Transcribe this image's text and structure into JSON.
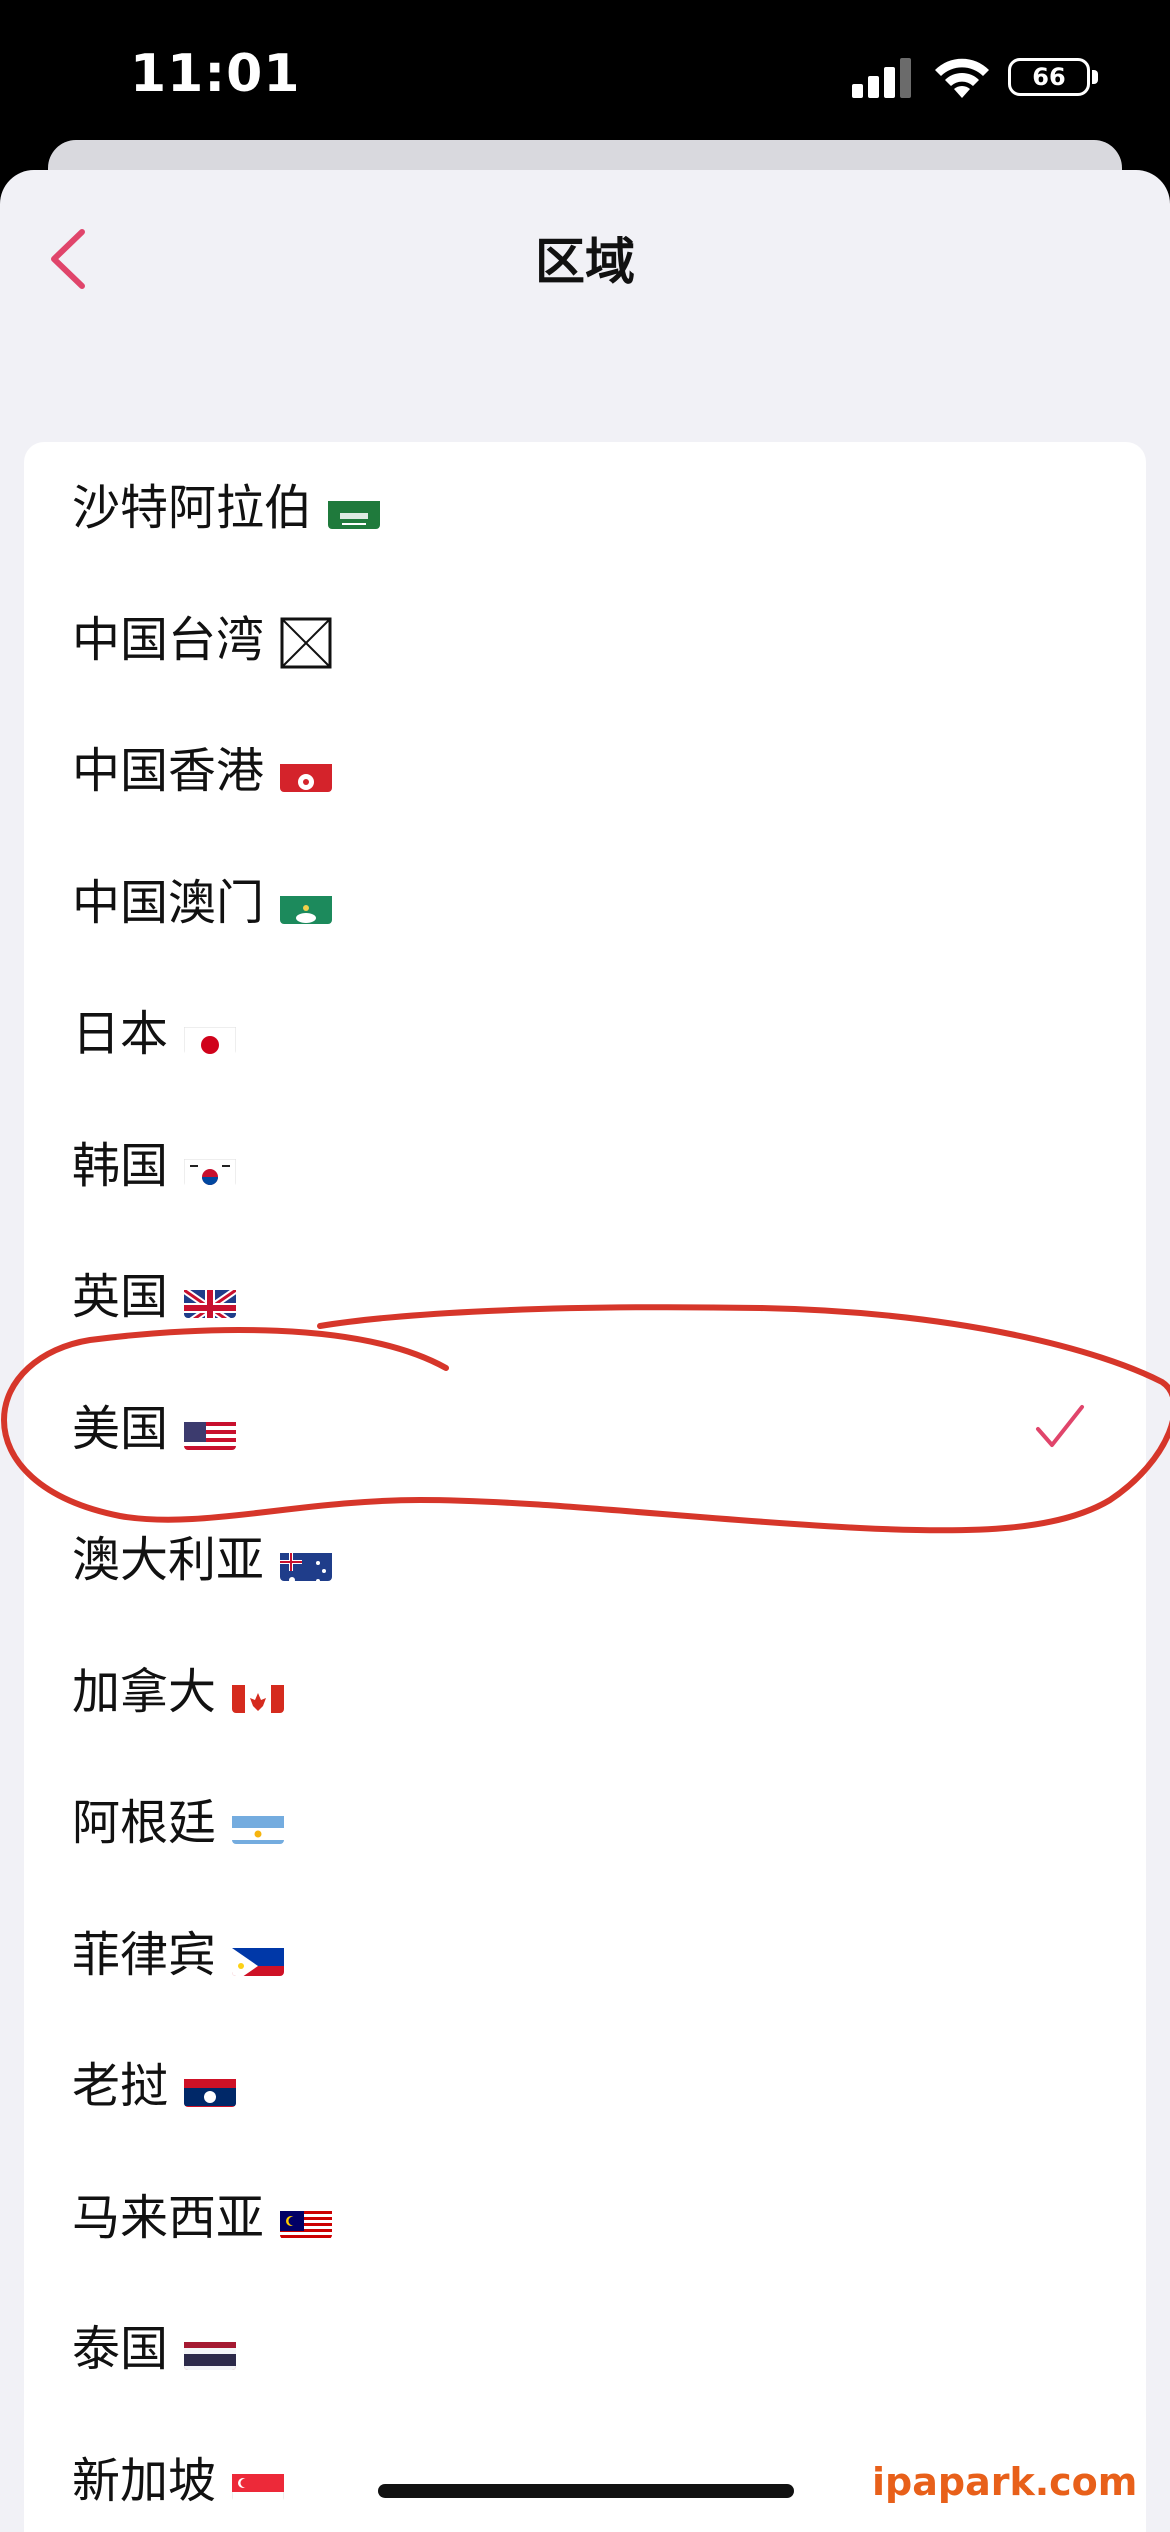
{
  "status": {
    "time": "11:01",
    "battery": "66"
  },
  "header": {
    "title": "区域"
  },
  "regions": [
    {
      "label": "沙特阿拉伯",
      "flag": "saudi-arabia"
    },
    {
      "label": "中国台湾",
      "flag": "placeholder-box"
    },
    {
      "label": "中国香港",
      "flag": "hong-kong"
    },
    {
      "label": "中国澳门",
      "flag": "macau"
    },
    {
      "label": "日本",
      "flag": "japan"
    },
    {
      "label": "韩国",
      "flag": "south-korea"
    },
    {
      "label": "英国",
      "flag": "united-kingdom"
    },
    {
      "label": "美国",
      "flag": "united-states",
      "selected": true
    },
    {
      "label": "澳大利亚",
      "flag": "australia"
    },
    {
      "label": "加拿大",
      "flag": "canada"
    },
    {
      "label": "阿根廷",
      "flag": "argentina"
    },
    {
      "label": "菲律宾",
      "flag": "philippines"
    },
    {
      "label": "老挝",
      "flag": "laos"
    },
    {
      "label": "马来西亚",
      "flag": "malaysia"
    },
    {
      "label": "泰国",
      "flag": "thailand"
    },
    {
      "label": "新加坡",
      "flag": "singapore"
    }
  ],
  "watermark": "ipapark.com",
  "colors": {
    "accent": "#e0456b",
    "annotation": "#d6362a",
    "watermark": "#e8601a"
  }
}
